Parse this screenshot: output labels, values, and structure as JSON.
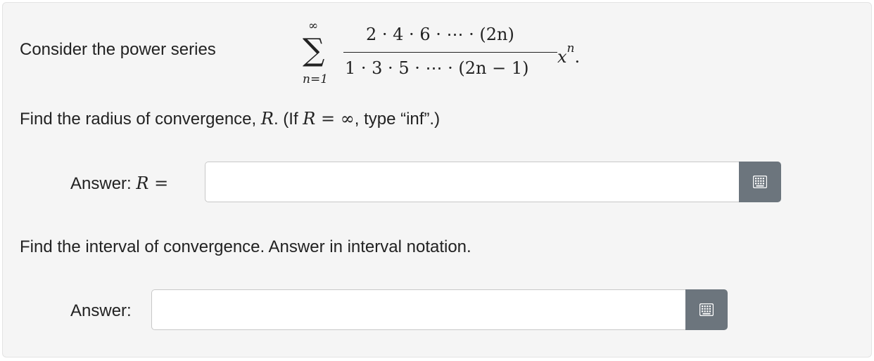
{
  "question": {
    "intro_label": "Consider the power series",
    "series": {
      "sum_symbol": "∑",
      "upper_limit": "∞",
      "lower_limit": "n=1",
      "numerator": "2 · 4 · 6 · ⋯ · (2n)",
      "denominator": "1 · 3 · 5 · ⋯ · (2n − 1)",
      "term_base": "x",
      "term_exponent": "n",
      "term_end": "."
    },
    "radius_prompt": {
      "text_before": "Find the radius of convergence, ",
      "variable": "R",
      "text_middle": ". (If ",
      "condition": "R = ∞",
      "text_after": ", type “inf”.)"
    },
    "radius_answer": {
      "label_text": "Answer: ",
      "label_var": "R",
      "label_eq": " =",
      "value": "",
      "button_icon": "keyboard-icon"
    },
    "interval_prompt": "Find the interval of convergence. Answer in interval notation.",
    "interval_answer": {
      "label": "Answer:",
      "value": "",
      "button_icon": "keyboard-icon"
    }
  },
  "colors": {
    "panel_background": "#f5f5f5",
    "text": "#222222",
    "button_background": "#6c757d",
    "button_icon": "#ffffff"
  }
}
